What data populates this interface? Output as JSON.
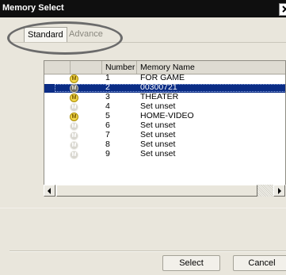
{
  "window": {
    "title": "Memory Select"
  },
  "tabs": [
    {
      "label": "Standard"
    },
    {
      "label": "Advance"
    }
  ],
  "list": {
    "columns": [
      "Number",
      "Memory Name"
    ],
    "rows": [
      {
        "number": "1",
        "name": "FOR GAME",
        "icon": "M"
      },
      {
        "number": "2",
        "name": "00300721",
        "icon": "M"
      },
      {
        "number": "3",
        "name": "THEATER",
        "icon": "M"
      },
      {
        "number": "4",
        "name": "Set unset",
        "icon": "M"
      },
      {
        "number": "5",
        "name": "HOME-VIDEO",
        "icon": "M"
      },
      {
        "number": "6",
        "name": "Set unset",
        "icon": "M"
      },
      {
        "number": "7",
        "name": "Set unset",
        "icon": "M"
      },
      {
        "number": "8",
        "name": "Set unset",
        "icon": "M"
      },
      {
        "number": "9",
        "name": "Set unset",
        "icon": "M"
      }
    ]
  },
  "buttons": {
    "select": "Select",
    "cancel": "Cancel"
  },
  "colors": {
    "selection": "#0a2c85",
    "memory_active": "#f1d64a"
  }
}
